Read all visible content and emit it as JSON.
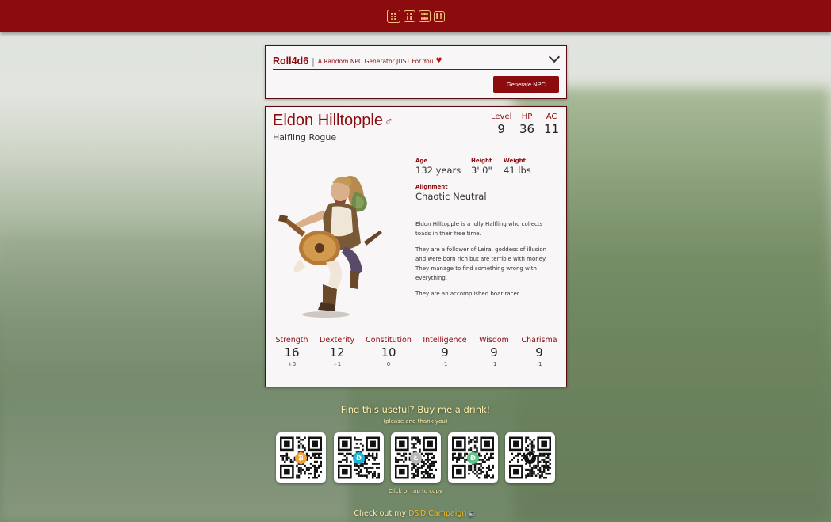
{
  "generator": {
    "brand": "Roll4d6",
    "separator": "|",
    "tagline": "A Random NPC Generator JUST For You",
    "button_label": "Generate NPC"
  },
  "npc": {
    "name": "Eldon Hilltopple",
    "gender_symbol": "♂",
    "subtitle": "Halfling Rogue",
    "level_label": "Level",
    "level": "9",
    "hp_label": "HP",
    "hp": "36",
    "ac_label": "AC",
    "ac": "11",
    "age_label": "Age",
    "age": "132 years",
    "height_label": "Height",
    "height": "3' 0\"",
    "weight_label": "Weight",
    "weight": "41 lbs",
    "alignment_label": "Alignment",
    "alignment": "Chaotic Neutral",
    "description": [
      "Eldon Hilltopple is a jolly Halfling who collects toads in their free time.",
      "They are a follower of Leira, goddess of illusion and were born rich but are terrible with money. They manage to find something wrong with everything.",
      "They are an accomplished boar racer."
    ],
    "abilities": [
      {
        "label": "Strength",
        "value": "16",
        "mod": "+3"
      },
      {
        "label": "Dexterity",
        "value": "12",
        "mod": "+1"
      },
      {
        "label": "Constitution",
        "value": "10",
        "mod": "0"
      },
      {
        "label": "Intelligence",
        "value": "9",
        "mod": "-1"
      },
      {
        "label": "Wisdom",
        "value": "9",
        "mod": "-1"
      },
      {
        "label": "Charisma",
        "value": "9",
        "mod": "-1"
      }
    ]
  },
  "donate": {
    "title": "Find this useful? Buy me a drink!",
    "subtitle": "(please and thank you)",
    "qr_codes": [
      {
        "icon": "bitcoin-icon",
        "glyph": "₿",
        "color": "#f2a33a"
      },
      {
        "icon": "dash-icon",
        "glyph": "Đ",
        "color": "#1fb6d6"
      },
      {
        "icon": "litecoin-icon",
        "glyph": "Ł",
        "color": "#b8b8b8"
      },
      {
        "icon": "dogecoin-icon",
        "glyph": "Ð",
        "color": "#5fc48a"
      },
      {
        "icon": "venmo-icon",
        "glyph": "V",
        "color": "#111111"
      }
    ],
    "hint": "Click or tap to copy"
  },
  "footer": {
    "prefix": "Check out my ",
    "link": "D&D Campaign"
  },
  "colors": {
    "accent": "#8b0b0f",
    "gold": "#f0c27a"
  }
}
